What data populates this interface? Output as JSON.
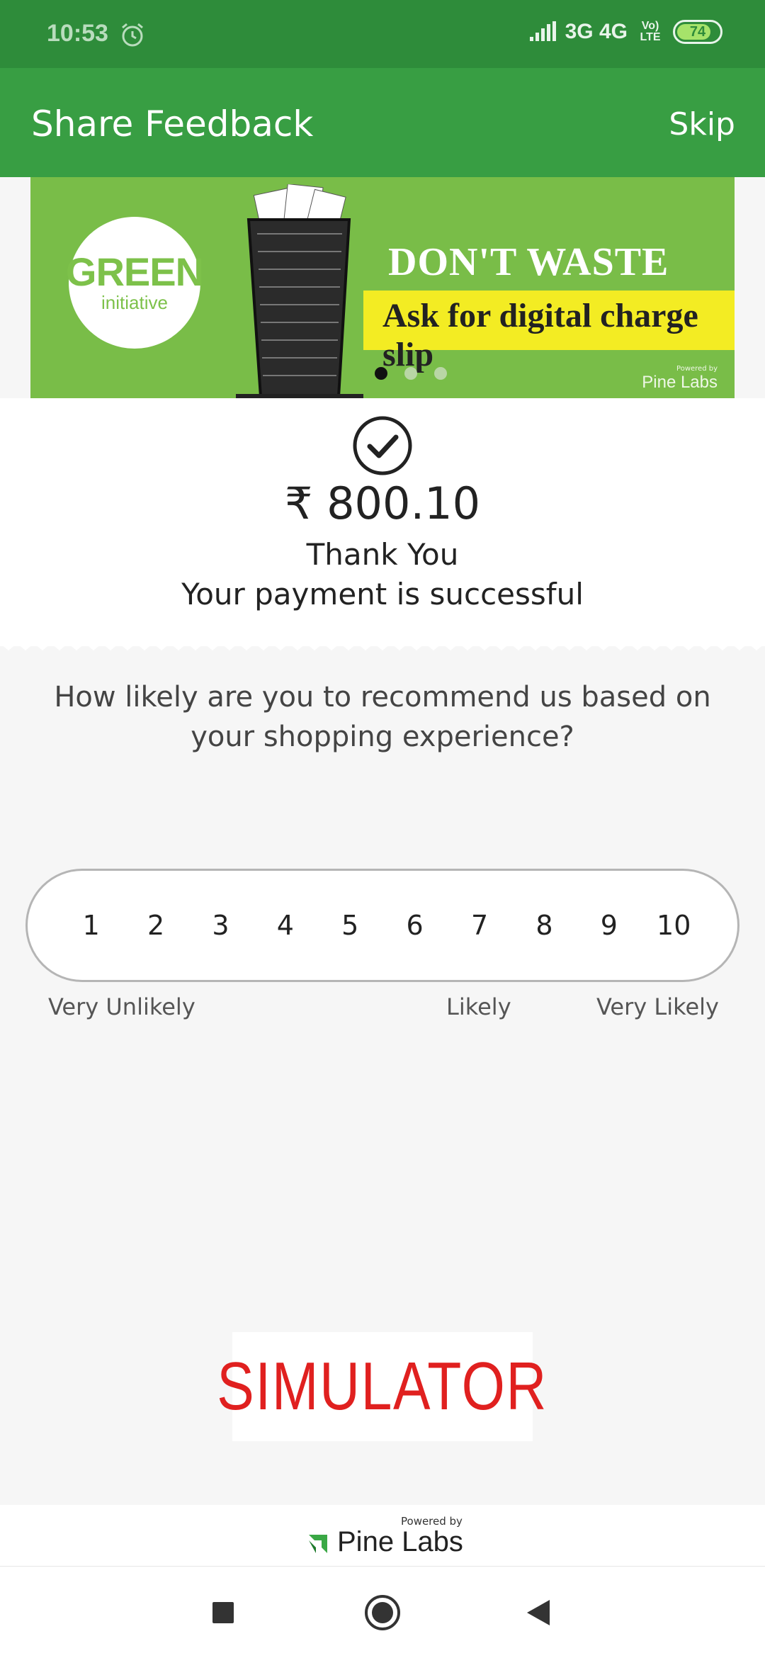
{
  "status_bar": {
    "time": "10:53",
    "network": "3G 4G",
    "volte": "Vo) LTE",
    "battery": "74",
    "alarm_icon": "alarm-clock-icon"
  },
  "app_bar": {
    "title": "Share Feedback",
    "skip_label": "Skip"
  },
  "banner": {
    "logo_line1": "GREEN",
    "logo_line2": "initiative",
    "headline": "DON'T WASTE PAPER",
    "subline": "Ask for digital charge slip",
    "powered_by": "Powered by",
    "brand": "Pine Labs",
    "slide_count": 3,
    "active_slide": 1
  },
  "receipt": {
    "amount": "₹ 800.10",
    "thanks": "Thank You",
    "message": "Your payment is successful"
  },
  "feedback": {
    "question": "How likely are you to recommend us based on your shopping experience?",
    "scale": [
      "1",
      "2",
      "3",
      "4",
      "5",
      "6",
      "7",
      "8",
      "9",
      "10"
    ],
    "label_low": "Very Unlikely",
    "label_mid": "Likely",
    "label_high": "Very Likely"
  },
  "simulator_logo": "SIMULATOR",
  "footer": {
    "powered_by": "Powered by",
    "brand": "Pine Labs"
  },
  "colors": {
    "status_bar": "#2e8c3a",
    "app_bar": "#389e43",
    "banner_green": "#79bd48",
    "banner_yellow": "#f3ec23",
    "simulator_red": "#e0201f"
  }
}
